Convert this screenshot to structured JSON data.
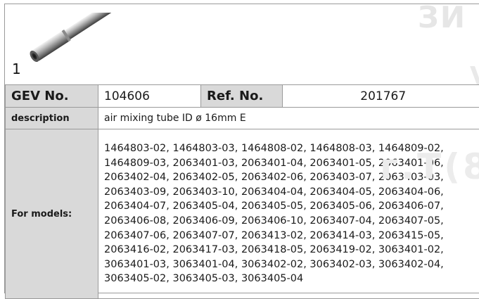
{
  "watermark": {
    "line1": "ЗИ",
    "line2": "г.Т(8",
    "line3": "V"
  },
  "item": {
    "index": "1",
    "image_icon": "air-mixing-tube-image"
  },
  "table": {
    "gev_label": "GEV No.",
    "gev_value": "104606",
    "ref_label": "Ref. No.",
    "ref_value": "201767",
    "desc_label": "description",
    "desc_value": "air mixing tube  ID ø 16mm E",
    "models_label": "For models:",
    "models_value": "1464803-02, 1464803-03, 1464808-02, 1464808-03, 1464809-02, 1464809-03, 2063401-03, 2063401-04, 2063401-05, 2063401-06, 2063402-04, 2063402-05, 2063402-06, 2063403-07, 2063403-03, 2063403-09, 2063403-10, 2063404-04, 2063404-05, 2063404-06, 2063404-07, 2063405-04, 2063405-05, 2063405-06, 2063406-07, 2063406-08, 2063406-09, 2063406-10, 2063407-04, 2063407-05, 2063407-06, 2063407-07, 2063413-02, 2063414-03, 2063415-05, 2063416-02, 2063417-03, 2063418-05, 2063419-02, 3063401-02, 3063401-03, 3063401-04, 3063402-02, 3063402-03, 3063402-04, 3063405-02, 3063405-03, 3063405-04"
  },
  "colors": {
    "header_bg": "#d9d9d9",
    "border": "#9a9a9a",
    "text": "#1a1a1a"
  }
}
